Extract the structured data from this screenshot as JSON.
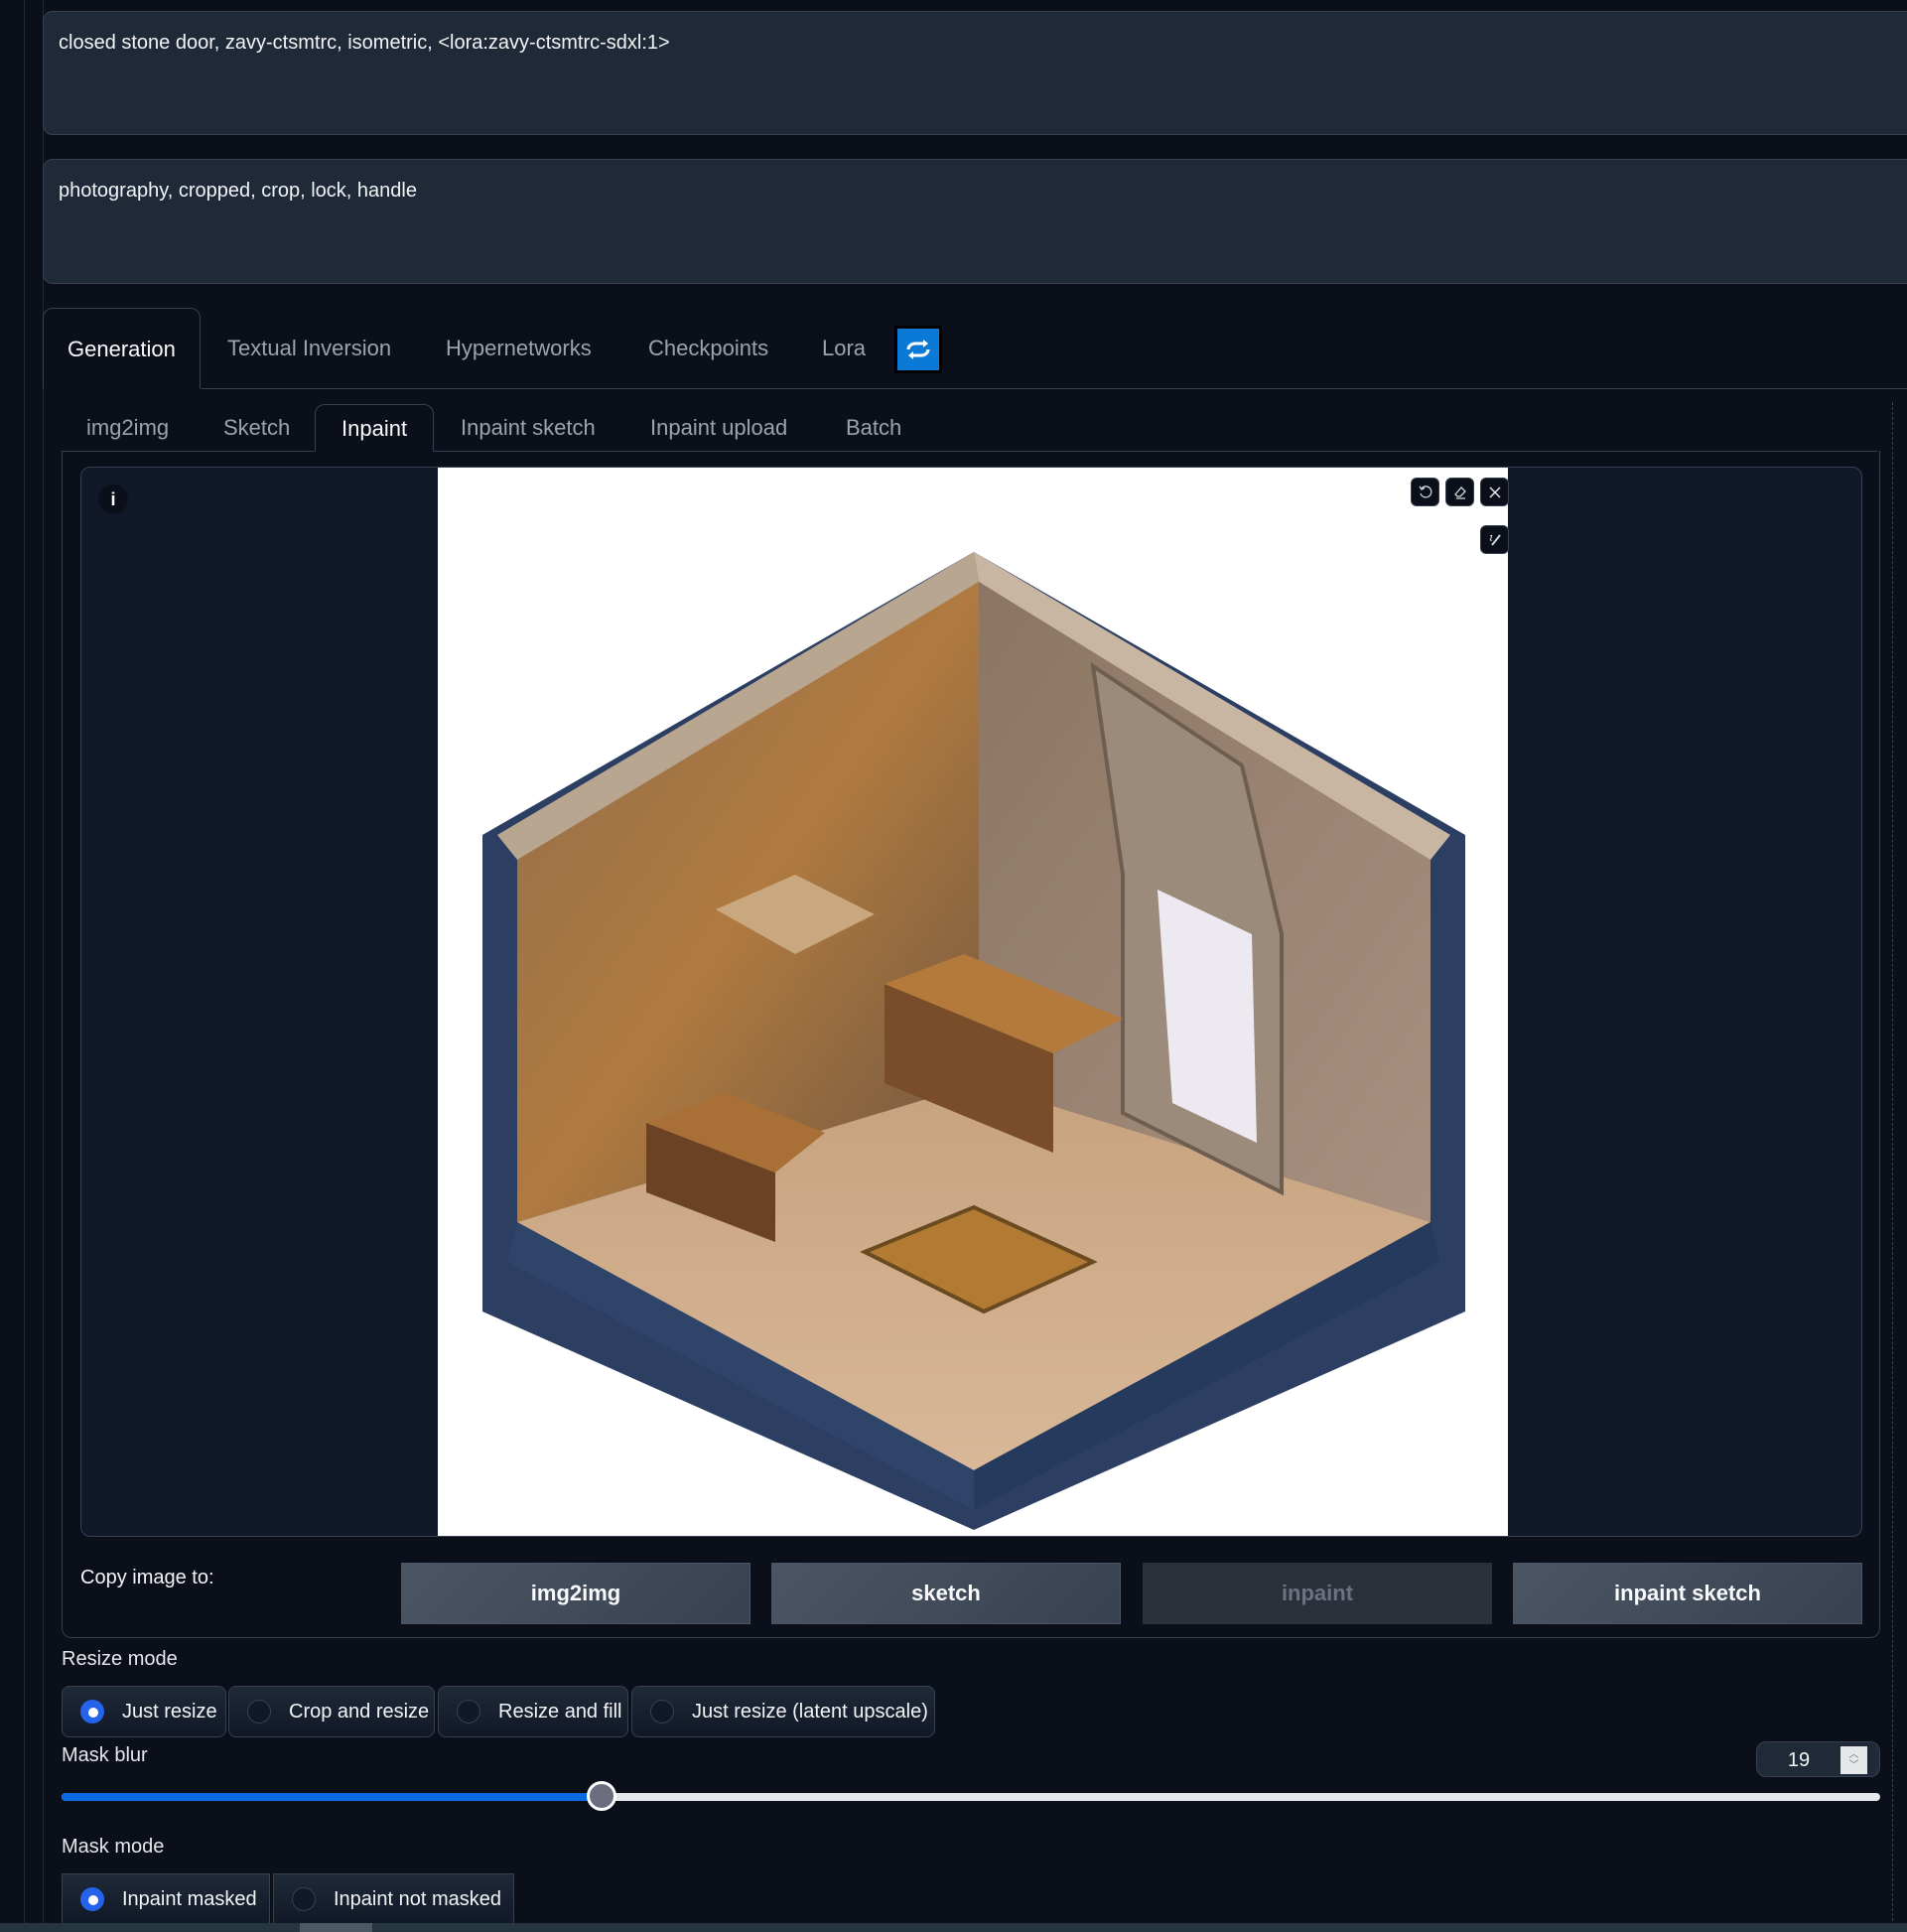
{
  "prompts": {
    "positive": "closed stone door, zavy-ctsmtrc, isometric, <lora:zavy-ctsmtrc-sdxl:1>",
    "negative": "photography, cropped, crop, lock, handle"
  },
  "extra_tabs": {
    "items": [
      {
        "label": "Generation",
        "active": true
      },
      {
        "label": "Textual Inversion",
        "active": false
      },
      {
        "label": "Hypernetworks",
        "active": false
      },
      {
        "label": "Checkpoints",
        "active": false
      },
      {
        "label": "Lora",
        "active": false
      }
    ],
    "refresh_icon": "refresh-icon",
    "refresh_color": "#0b79d6"
  },
  "mode_tabs": {
    "items": [
      {
        "label": "img2img",
        "active": false
      },
      {
        "label": "Sketch",
        "active": false
      },
      {
        "label": "Inpaint",
        "active": true
      },
      {
        "label": "Inpaint sketch",
        "active": false
      },
      {
        "label": "Inpaint upload",
        "active": false
      },
      {
        "label": "Batch",
        "active": false
      }
    ]
  },
  "canvas": {
    "info_icon": "i",
    "tools": [
      "undo-icon",
      "eraser-icon",
      "close-icon",
      "brush-icon"
    ],
    "image_description": "isometric stone room with closed door (masked area white)"
  },
  "copy_image": {
    "label": "Copy image to:",
    "buttons": [
      {
        "label": "img2img",
        "disabled": false
      },
      {
        "label": "sketch",
        "disabled": false
      },
      {
        "label": "inpaint",
        "disabled": true
      },
      {
        "label": "inpaint sketch",
        "disabled": false
      }
    ]
  },
  "resize_mode": {
    "label": "Resize mode",
    "options": [
      "Just resize",
      "Crop and resize",
      "Resize and fill",
      "Just resize (latent upscale)"
    ],
    "selected": "Just resize"
  },
  "mask_blur": {
    "label": "Mask blur",
    "value": "19",
    "min": 0,
    "max": 64,
    "accent": "#0b6ae0"
  },
  "mask_mode": {
    "label": "Mask mode",
    "options": [
      "Inpaint masked",
      "Inpaint not masked"
    ],
    "selected": "Inpaint masked"
  }
}
